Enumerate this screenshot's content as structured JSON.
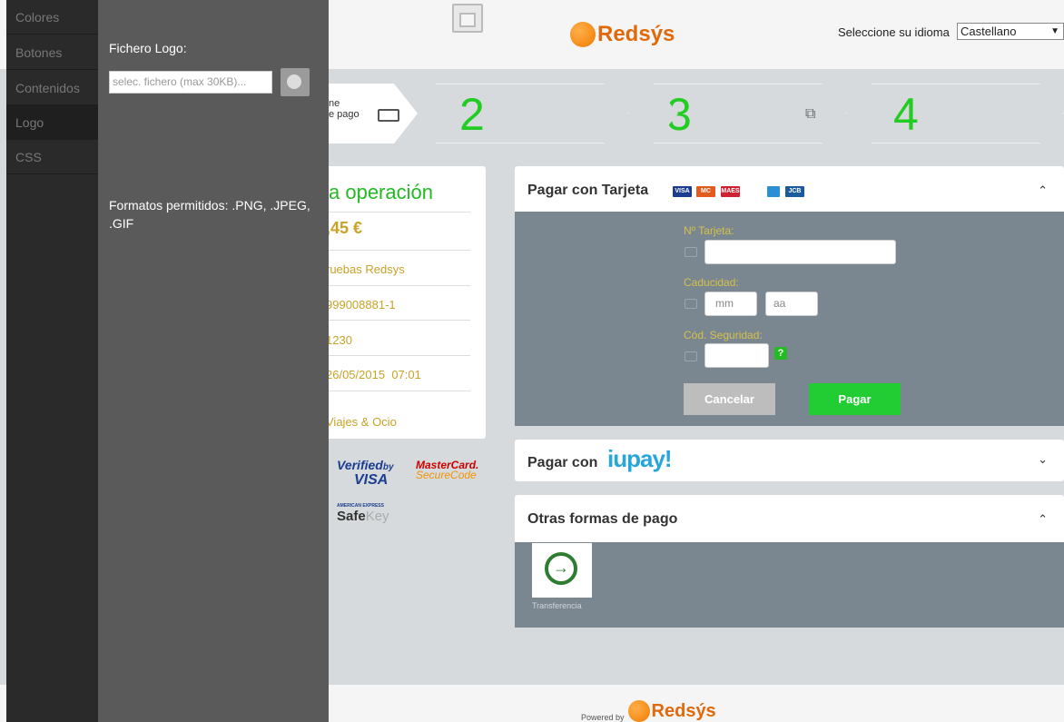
{
  "header": {
    "logo_text": "Redsýs",
    "language_label": "Seleccione su idioma",
    "language_value": "Castellano"
  },
  "steps": {
    "step1_text": "ne\ne pago",
    "step2_number": "2",
    "step3_number": "3",
    "step4_number": "4"
  },
  "operation": {
    "title": "a operación",
    "amount": ",45 €",
    "merchant": "ruebas Redsys",
    "merchant_code": "999008881-1",
    "terminal": "1230",
    "date": "26/05/2015",
    "time": "07:01",
    "description": "Viajes & Ocio"
  },
  "security_logos": {
    "verified_line1": "Verified",
    "verified_by": "by",
    "verified_line2": "VISA",
    "mastercard_line1": "MasterCard.",
    "mastercard_line2": "SecureCode",
    "amex_small": "AMERICAN EXPRESS",
    "safekey_safe": "Safe",
    "safekey_key": "Key"
  },
  "card_panel": {
    "title": "Pagar con Tarjeta",
    "card_brands": [
      "VISA",
      "MC",
      "MAES",
      "AMEX",
      "JCB"
    ],
    "pan_label": "Nº Tarjeta:",
    "expiry_label": "Caducidad:",
    "month_placeholder": "mm",
    "year_placeholder": "aa",
    "cvv_label": "Cód. Seguridad:",
    "cvv_help": "?",
    "cancel_label": "Cancelar",
    "pay_label": "Pagar"
  },
  "iupay_panel": {
    "title": "Pagar con",
    "brand": "iupay!"
  },
  "other_panel": {
    "title": "Otras formas de pago",
    "transfer_label": "Transferencia"
  },
  "footer": {
    "powered_by": "Powered by",
    "logo_text": "Redsýs"
  },
  "editor": {
    "nav": [
      "Colores",
      "Botones",
      "Contenidos",
      "Logo",
      "CSS"
    ],
    "active_nav": "Logo",
    "field_label": "Fichero Logo:",
    "file_placeholder": "selec. fichero (max 30KB)...",
    "formats_text": "Formatos permitidos: .PNG, .JPEG, .GIF"
  },
  "colors": {
    "accent_green": "#22cc33",
    "brand_orange": "#e0690c",
    "label_gold": "#c9a227"
  }
}
